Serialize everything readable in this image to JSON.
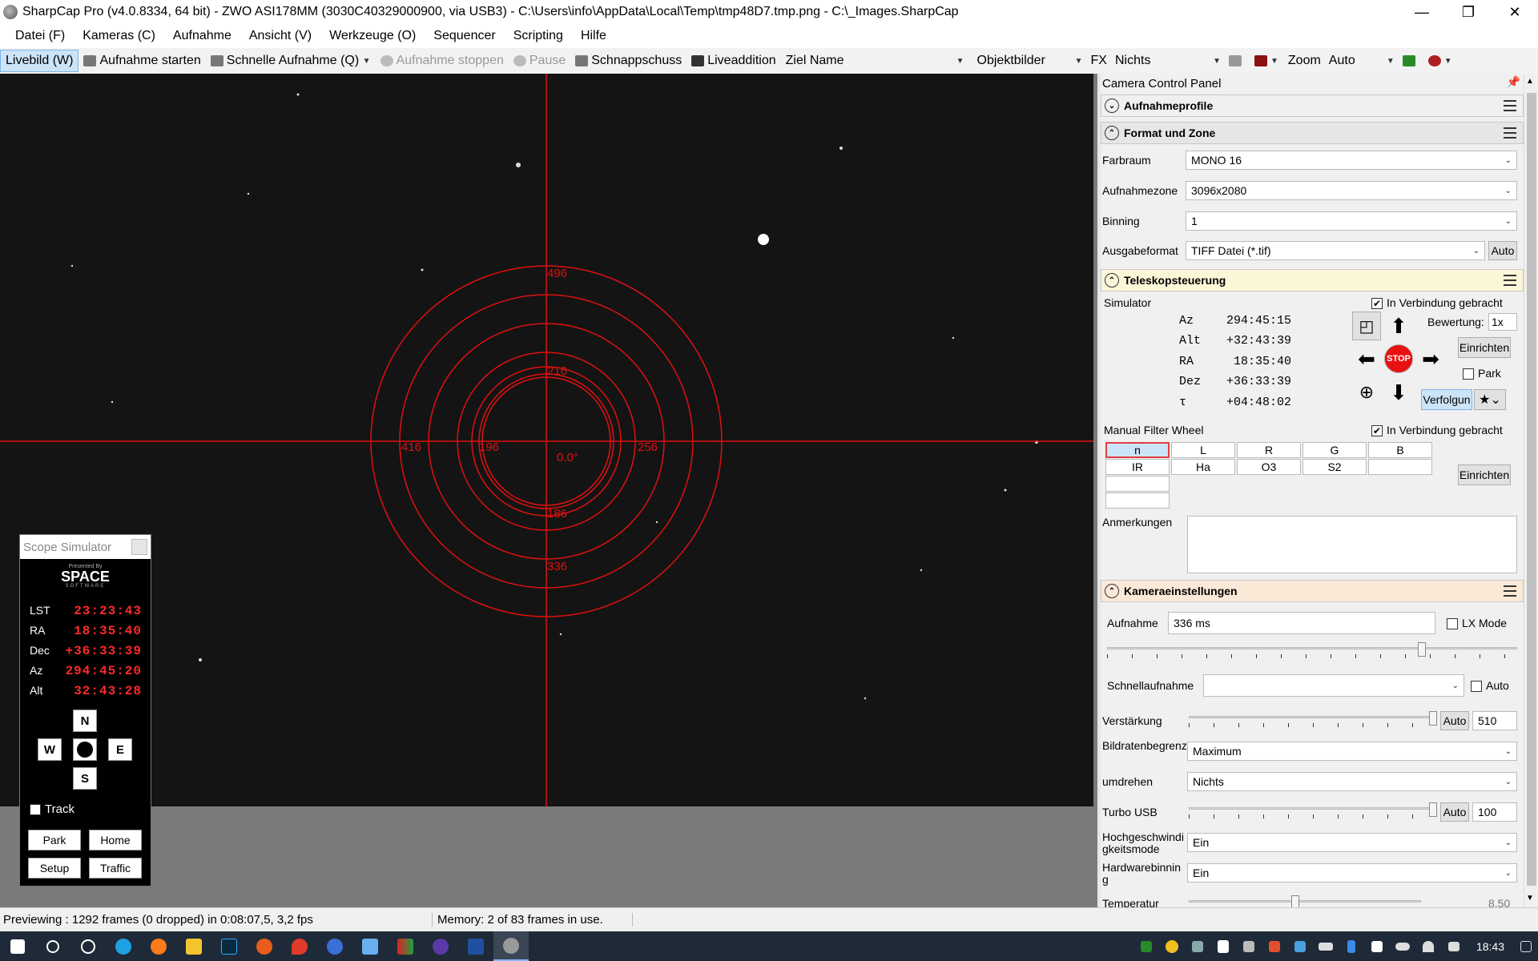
{
  "window": {
    "title": "SharpCap Pro (v4.0.8334, 64 bit) - ZWO ASI178MM (3030C40329000900, via USB3) - C:\\Users\\info\\AppData\\Local\\Temp\\tmp48D7.tmp.png - C:\\_Images.SharpCap",
    "minimize": "—",
    "maximize": "❐",
    "close": "✕"
  },
  "menu": [
    "Datei (F)",
    "Kameras (C)",
    "Aufnahme",
    "Ansicht (V)",
    "Werkzeuge (O)",
    "Sequencer",
    "Scripting",
    "Hilfe"
  ],
  "toolbar": {
    "livebild": "Livebild (W)",
    "aufnahme_starten": "Aufnahme starten",
    "schnelle_aufnahme": "Schnelle Aufnahme (Q)",
    "aufnahme_stoppen": "Aufnahme stoppen",
    "pause": "Pause",
    "schnappschuss": "Schnappschuss",
    "liveaddition": "Liveaddition",
    "ziel_name": "Ziel Name",
    "ziel_value": "",
    "objektbilder": "Objektbilder",
    "fx": "FX",
    "fx_value": "Nichts",
    "zoom": "Zoom",
    "zoom_value": "Auto"
  },
  "overlay": {
    "labels": [
      "496",
      "416",
      "336",
      "256",
      "216",
      "196",
      "186",
      "0.0°"
    ],
    "color": "#e01010"
  },
  "panel": {
    "title": "Camera Control Panel",
    "sections": {
      "aufnahmeprofile": "Aufnahmeprofile",
      "format": "Format und Zone",
      "teleskop": "Teleskopsteuerung",
      "kamera": "Kameraeinstellungen"
    },
    "format": {
      "farbraum_label": "Farbraum",
      "farbraum_value": "MONO 16",
      "zone_label": "Aufnahmezone",
      "zone_value": "3096x2080",
      "binning_label": "Binning",
      "binning_value": "1",
      "ausgabe_label": "Ausgabeformat",
      "ausgabe_value": "TIFF Datei (*.tif)",
      "auto": "Auto"
    },
    "teleskop": {
      "name": "Simulator",
      "connected": "In Verbindung gebracht",
      "rows": [
        {
          "k": "Az",
          "v": "294:45:15"
        },
        {
          "k": "Alt",
          "v": "+32:43:39"
        },
        {
          "k": "RA",
          "v": "18:35:40"
        },
        {
          "k": "Dez",
          "v": "+36:33:39"
        },
        {
          "k": "τ",
          "v": "+04:48:02"
        }
      ],
      "bewertung_label": "Bewertung:",
      "bewertung_value": "1x",
      "einrichten": "Einrichten",
      "park": "Park",
      "verfolgung": "Verfolgun",
      "stop": "STOP"
    },
    "filter": {
      "title": "Manual Filter Wheel",
      "connected": "In Verbindung gebracht",
      "row1": [
        "n",
        "L",
        "R",
        "G",
        "B"
      ],
      "row2": [
        "IR",
        "Ha",
        "O3",
        "S2",
        ""
      ],
      "einrichten": "Einrichten"
    },
    "anmerkungen": "Anmerkungen",
    "kamera": {
      "aufnahme_label": "Aufnahme",
      "aufnahme_value": "336 ms",
      "lx": "LX Mode",
      "schnell_label": "Schnellaufnahme",
      "schnell_auto": "Auto",
      "verst_label": "Verstärkung",
      "verst_auto": "Auto",
      "verst_value": "510",
      "bild_label": "Bildratenbegrenzung",
      "bild_value": "Maximum",
      "umdrehen_label": "umdrehen",
      "umdrehen_value": "Nichts",
      "turbo_label": "Turbo USB",
      "turbo_auto": "Auto",
      "turbo_value": "100",
      "hoch_label": "Hochgeschwindigkeitsmode",
      "hoch_value": "Ein",
      "hw_label": "Hardwarebinning",
      "hw_value": "Ein",
      "temp_label": "Temperatur",
      "temp_value": "8.50"
    }
  },
  "status": {
    "left": "Previewing : 1292 frames (0 dropped) in 0:08:07,5, 3,2 fps",
    "right": "Memory: 2 of 83 frames in use."
  },
  "scope": {
    "title": "Scope Simulator",
    "presented": "Presented By",
    "brand": "SPACE",
    "brand_sub": "SOFTWARE",
    "rows": [
      {
        "k": "LST",
        "v": "23:23:43"
      },
      {
        "k": "RA",
        "v": "18:35:40"
      },
      {
        "k": "Dec",
        "v": "+36:33:39"
      },
      {
        "k": "Az",
        "v": "294:45:20"
      },
      {
        "k": "Alt",
        "v": "32:43:28"
      }
    ],
    "n": "N",
    "w": "W",
    "e": "E",
    "s": "S",
    "track": "Track",
    "park": "Park",
    "home": "Home",
    "setup": "Setup",
    "traffic": "Traffic"
  },
  "taskbar": {
    "time": "18:43"
  }
}
